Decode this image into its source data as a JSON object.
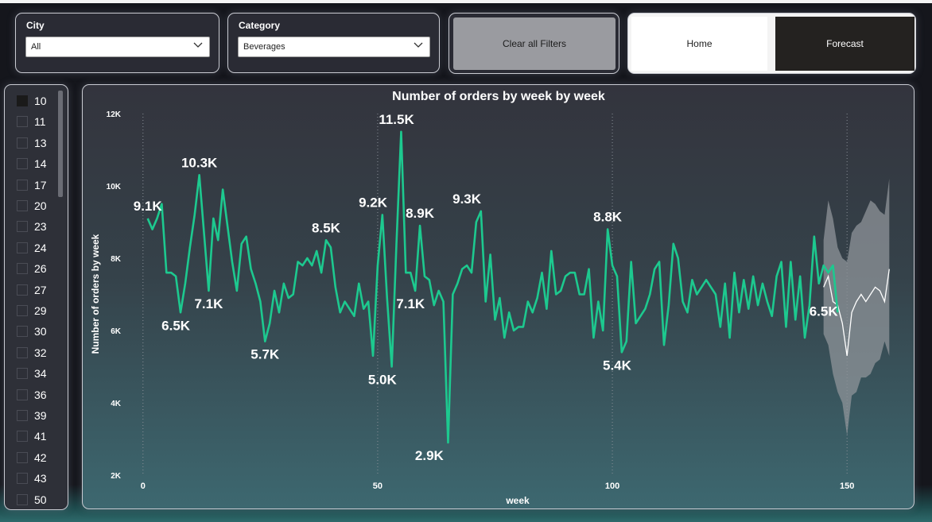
{
  "filters": {
    "city": {
      "title": "City",
      "value": "All"
    },
    "category": {
      "title": "Category",
      "value": "Beverages"
    },
    "clear_button": "Clear all Filters"
  },
  "nav": {
    "home": "Home",
    "forecast": "Forecast"
  },
  "week_slicer": {
    "items": [
      "10",
      "11",
      "13",
      "14",
      "17",
      "20",
      "23",
      "24",
      "26",
      "27",
      "29",
      "30",
      "32",
      "34",
      "36",
      "39",
      "41",
      "42",
      "43",
      "50"
    ],
    "selected": "10"
  },
  "colors": {
    "line": "#1dc98f",
    "forecast_band": "#8f9499",
    "forecast_line": "#ffffff"
  },
  "chart_data": {
    "type": "line",
    "title": "Number of orders by week by week",
    "xlabel": "week",
    "ylabel": "Number of orders by week",
    "xlim": [
      -2,
      162
    ],
    "ylim": [
      2000,
      12000
    ],
    "x_ticks": [
      0,
      50,
      100,
      150
    ],
    "y_ticks": [
      2000,
      4000,
      6000,
      8000,
      10000,
      12000
    ],
    "y_tick_labels": [
      "2K",
      "4K",
      "6K",
      "8K",
      "10K",
      "12K"
    ],
    "grid": "vertical dotted",
    "series": [
      {
        "values": [
          9100,
          8800,
          9100,
          9500,
          7600,
          7600,
          7500,
          6500,
          7300,
          8300,
          9200,
          10300,
          8700,
          7100,
          9100,
          8500,
          9900,
          8900,
          7900,
          7100,
          8400,
          8600,
          7700,
          7300,
          6800,
          5700,
          6200,
          7100,
          6500,
          7300,
          6900,
          7000,
          7900,
          7800,
          8000,
          7800,
          8200,
          7600,
          8500,
          8300,
          7200,
          6500,
          6800,
          6600,
          6400,
          7300,
          6600,
          6800,
          5300,
          7800,
          9200,
          6900,
          5000,
          8400,
          11500,
          7600,
          7600,
          7100,
          8900,
          7500,
          7400,
          6700,
          7100,
          6800,
          2900,
          7000,
          7300,
          7700,
          7800,
          7600,
          9000,
          9300,
          6800,
          8100,
          6300,
          6900,
          5800,
          6500,
          6000,
          6100,
          6100,
          6800,
          6500,
          6900,
          7600,
          6600,
          8200,
          7000,
          7100,
          7500,
          7600,
          7600,
          7000,
          7000,
          7700,
          5800,
          6800,
          6000,
          8800,
          7800,
          7500,
          5400,
          5700,
          7900,
          6200,
          6400,
          6600,
          7000,
          7700,
          7900,
          5600,
          6700,
          8400,
          8000,
          6800,
          6500,
          7400,
          7000,
          7200,
          7400,
          7200,
          7000,
          6100,
          7300,
          5800,
          7600,
          6500,
          7400,
          6600,
          7500,
          6700,
          7300,
          6800,
          6400,
          7500,
          7900,
          6100,
          7900,
          6300,
          7500,
          5800,
          6700,
          8600,
          7300,
          7800,
          7600,
          7800,
          6500
        ],
        "x_start": 1
      }
    ],
    "forecast": {
      "x": [
        145,
        146,
        147,
        148,
        149,
        150,
        151,
        152,
        153,
        154,
        155,
        156,
        157,
        158,
        159
      ],
      "values": [
        7200,
        7500,
        6800,
        6700,
        6200,
        5300,
        6500,
        6800,
        7000,
        6800,
        7000,
        7200,
        7100,
        6800,
        7700
      ],
      "upper": [
        8500,
        9600,
        9100,
        8300,
        8000,
        7900,
        8700,
        8900,
        9000,
        9300,
        9600,
        9500,
        9300,
        9200,
        10200
      ],
      "lower": [
        5900,
        5600,
        4800,
        4300,
        4000,
        3100,
        4200,
        4300,
        4700,
        4700,
        4800,
        5100,
        5200,
        5700,
        5300
      ]
    },
    "annotations": [
      {
        "x": 1,
        "y": 9100,
        "text": "9.1K"
      },
      {
        "x": 7,
        "y": 6500,
        "text": "6.5K"
      },
      {
        "x": 12,
        "y": 10300,
        "text": "10.3K"
      },
      {
        "x": 14,
        "y": 7100,
        "text": "7.1K"
      },
      {
        "x": 26,
        "y": 5700,
        "text": "5.7K"
      },
      {
        "x": 39,
        "y": 8500,
        "text": "8.5K"
      },
      {
        "x": 49,
        "y": 9200,
        "text": "9.2K"
      },
      {
        "x": 51,
        "y": 5000,
        "text": "5.0K"
      },
      {
        "x": 54,
        "y": 11500,
        "text": "11.5K"
      },
      {
        "x": 59,
        "y": 8900,
        "text": "8.9K"
      },
      {
        "x": 57,
        "y": 7100,
        "text": "7.1K"
      },
      {
        "x": 61,
        "y": 2900,
        "text": "2.9K"
      },
      {
        "x": 69,
        "y": 9300,
        "text": "9.3K"
      },
      {
        "x": 99,
        "y": 8800,
        "text": "8.8K"
      },
      {
        "x": 101,
        "y": 5400,
        "text": "5.4K"
      },
      {
        "x": 145,
        "y": 6500,
        "text": "6.5K"
      }
    ]
  }
}
